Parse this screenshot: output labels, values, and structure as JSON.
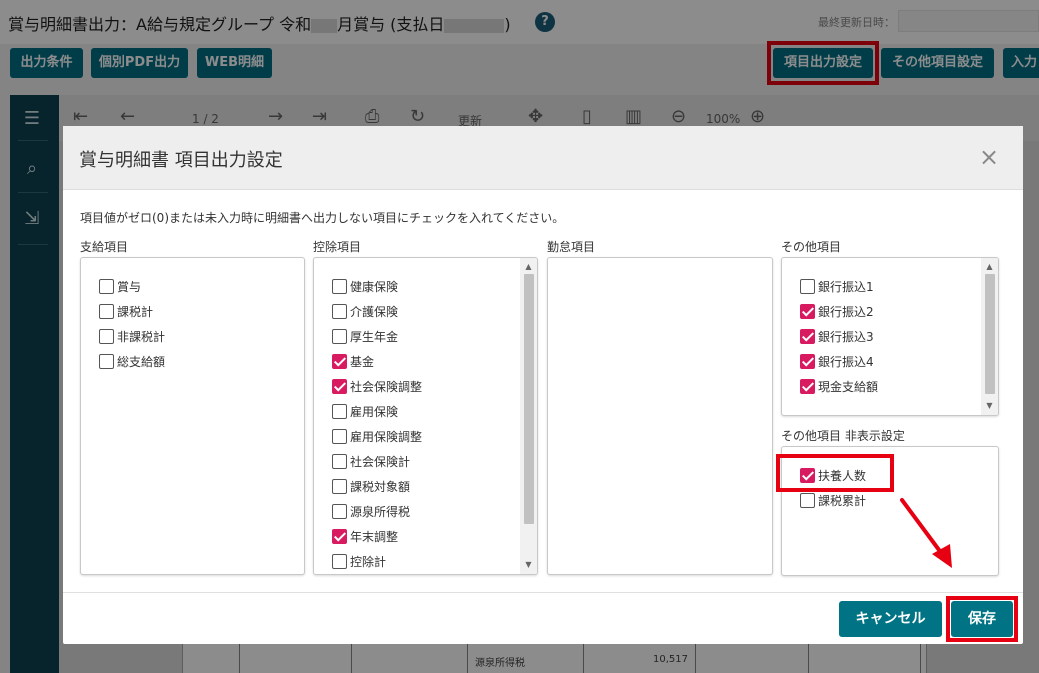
{
  "header": {
    "title_prefix": "賞与明細書出力：A給与規定グループ 令和",
    "title_mid": "月賞与 (支払日",
    "title_suffix": ")",
    "help_icon": "?",
    "last_updated_label": "最終更新日時："
  },
  "toolbar": {
    "output_conditions": "出力条件",
    "individual_pdf": "個別PDF出力",
    "web_statement": "WEB明細",
    "item_output_settings": "項目出力設定",
    "other_item_settings": "その他項目設定",
    "input": "入力"
  },
  "viewer": {
    "page_indicator": "1 / 2",
    "refresh_label": "更新",
    "zoom": "100%",
    "pdf_row_label": "源泉所得税",
    "pdf_row_value": "10,517"
  },
  "modal": {
    "title": "賞与明細書 項目出力設定",
    "close": "×",
    "instruction": "項目値がゼロ(0)または未入力時に明細書へ出力しない項目にチェックを入れてください。",
    "columns": {
      "payment": {
        "label": "支給項目",
        "items": [
          {
            "label": "賞与",
            "checked": false
          },
          {
            "label": "課税計",
            "checked": false
          },
          {
            "label": "非課税計",
            "checked": false
          },
          {
            "label": "総支給額",
            "checked": false
          }
        ]
      },
      "deduction": {
        "label": "控除項目",
        "items": [
          {
            "label": "健康保険",
            "checked": false
          },
          {
            "label": "介護保険",
            "checked": false
          },
          {
            "label": "厚生年金",
            "checked": false
          },
          {
            "label": "基金",
            "checked": true
          },
          {
            "label": "社会保険調整",
            "checked": true
          },
          {
            "label": "雇用保険",
            "checked": false
          },
          {
            "label": "雇用保険調整",
            "checked": false
          },
          {
            "label": "社会保険計",
            "checked": false
          },
          {
            "label": "課税対象額",
            "checked": false
          },
          {
            "label": "源泉所得税",
            "checked": false
          },
          {
            "label": "年末調整",
            "checked": true
          },
          {
            "label": "控除計",
            "checked": false
          }
        ]
      },
      "attendance": {
        "label": "勤怠項目",
        "items": []
      },
      "other": {
        "label": "その他項目",
        "items": [
          {
            "label": "銀行振込1",
            "checked": false
          },
          {
            "label": "銀行振込2",
            "checked": true
          },
          {
            "label": "銀行振込3",
            "checked": true
          },
          {
            "label": "銀行振込4",
            "checked": true
          },
          {
            "label": "現金支給額",
            "checked": true
          }
        ]
      },
      "other_hidden": {
        "label": "その他項目 非表示設定",
        "items": [
          {
            "label": "扶養人数",
            "checked": true
          },
          {
            "label": "課税累計",
            "checked": false
          }
        ]
      }
    },
    "cancel_button": "キャンセル",
    "save_button": "保存"
  },
  "colors": {
    "accent": "#006f86",
    "checkbox_checked": "#d81b60",
    "highlight": "#e60012",
    "sidebar": "#0e4350"
  }
}
